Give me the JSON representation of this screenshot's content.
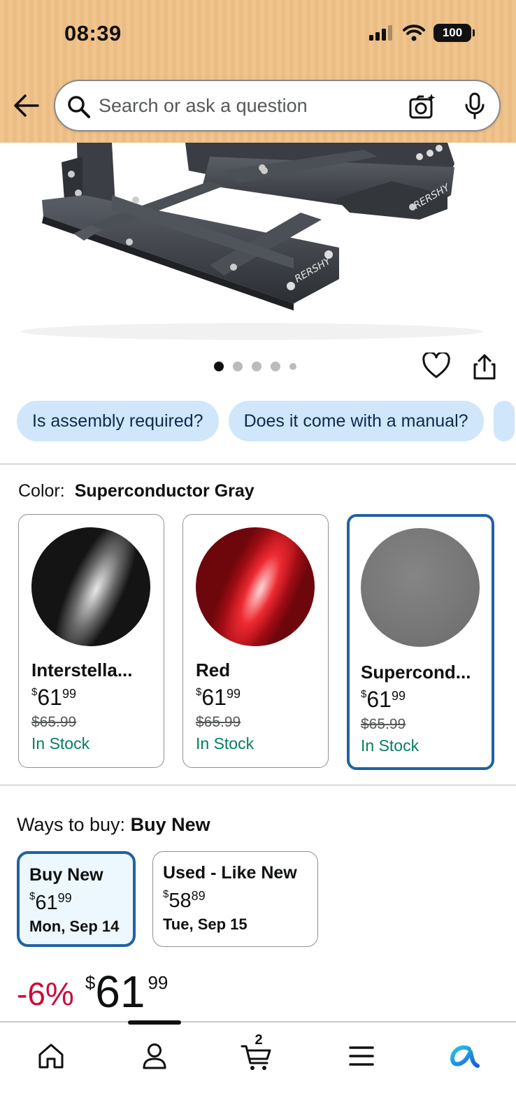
{
  "status_bar": {
    "time": "08:39",
    "battery": "100"
  },
  "search": {
    "placeholder": "Search or ask a question"
  },
  "gallery": {
    "image_count": 5,
    "active_index": 0
  },
  "quick_questions": [
    "Is assembly required?",
    "Does it come with a manual?"
  ],
  "color": {
    "label": "Color:",
    "selected": "Superconductor Gray",
    "options": [
      {
        "name": "Interstella...",
        "currency": "$",
        "whole": "61",
        "cents": "99",
        "list_price": "$65.99",
        "stock": "In Stock",
        "swatch": "#1a1a1a"
      },
      {
        "name": "Red",
        "currency": "$",
        "whole": "61",
        "cents": "99",
        "list_price": "$65.99",
        "stock": "In Stock",
        "swatch": "#c8121c"
      },
      {
        "name": "Supercond...",
        "currency": "$",
        "whole": "61",
        "cents": "99",
        "list_price": "$65.99",
        "stock": "In Stock",
        "swatch": "#7b7b7b"
      }
    ]
  },
  "ways_to_buy": {
    "label": "Ways to buy:",
    "selected": "Buy New",
    "options": [
      {
        "title": "Buy New",
        "currency": "$",
        "whole": "61",
        "cents": "99",
        "date": "Mon, Sep 14"
      },
      {
        "title": "Used - Like New",
        "currency": "$",
        "whole": "58",
        "cents": "89",
        "date": "Tue, Sep 15"
      }
    ]
  },
  "price": {
    "discount": "-6%",
    "currency": "$",
    "whole": "61",
    "cents": "99"
  },
  "nav": {
    "cart_count": "2"
  },
  "colors": {
    "header_bg": "#f0c48d",
    "chip_bg": "#cfe6fb",
    "selected_border": "#2162a1",
    "in_stock": "#067d62",
    "discount": "#cc0c39"
  }
}
